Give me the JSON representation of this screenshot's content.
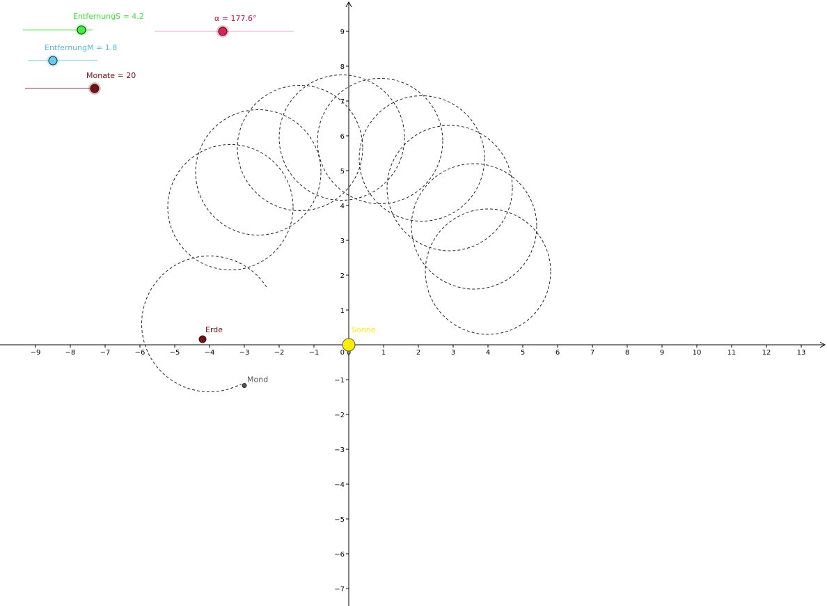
{
  "sliders": [
    {
      "id": "entfernungS",
      "label": "EntfernungS = 4.2",
      "value": 4.2,
      "fraction": 0.84,
      "color": "#33ee33",
      "knob_fill": "#44ee44"
    },
    {
      "id": "alpha",
      "label": "α = 177.6°",
      "value": 177.6,
      "fraction": 0.49,
      "color": "#cc1144",
      "knob_fill": "#dd2255"
    },
    {
      "id": "entfernungM",
      "label": "EntfernungM = 1.8",
      "value": 1.8,
      "fraction": 0.36,
      "color": "#55bbdd",
      "knob_fill": "#66ccee"
    },
    {
      "id": "monate",
      "label": "Monate = 20",
      "value": 20,
      "fraction": 0.999,
      "color": "#7a0c12",
      "knob_fill": "#7a0c12"
    }
  ],
  "axes": {
    "x_range": [
      -10,
      13.7
    ],
    "y_range": [
      -7.5,
      9.9
    ],
    "x_ticks": [
      -9,
      -8,
      -7,
      -6,
      -5,
      -4,
      -3,
      -2,
      -1,
      0,
      1,
      2,
      3,
      4,
      5,
      6,
      7,
      8,
      9,
      10,
      11,
      12,
      13
    ],
    "y_ticks": [
      -7,
      -6,
      -5,
      -4,
      -3,
      -2,
      -1,
      1,
      2,
      3,
      4,
      5,
      6,
      7,
      8,
      9
    ],
    "origin_label": "0"
  },
  "points": {
    "sonne": {
      "label": "Sonne",
      "x": 0,
      "y": 0,
      "color": "#ffee00"
    },
    "erde": {
      "label": "Erde",
      "x": -4.2,
      "y": 0.16,
      "color": "#7a0c12"
    },
    "mond": {
      "label": "Mond",
      "x": -3.0,
      "y": -1.17,
      "color": "#555555"
    }
  },
  "orbit_circles": [
    {
      "cx": 4.0,
      "cy": 2.1,
      "r": 1.8
    },
    {
      "cx": 3.6,
      "cy": 3.4,
      "r": 1.8
    },
    {
      "cx": 2.9,
      "cy": 4.5,
      "r": 1.8
    },
    {
      "cx": 2.1,
      "cy": 5.35,
      "r": 1.8
    },
    {
      "cx": 0.9,
      "cy": 5.85,
      "r": 1.8
    },
    {
      "cx": -0.2,
      "cy": 5.95,
      "r": 1.8
    },
    {
      "cx": -1.4,
      "cy": 5.65,
      "r": 1.8
    },
    {
      "cx": -2.6,
      "cy": 4.95,
      "r": 1.8
    },
    {
      "cx": -3.4,
      "cy": 3.95,
      "r": 1.8
    }
  ],
  "moon_arc": {
    "cx": -4.0,
    "cy": 0.6,
    "r": 1.95,
    "start_deg": 33,
    "end_deg": 298
  }
}
